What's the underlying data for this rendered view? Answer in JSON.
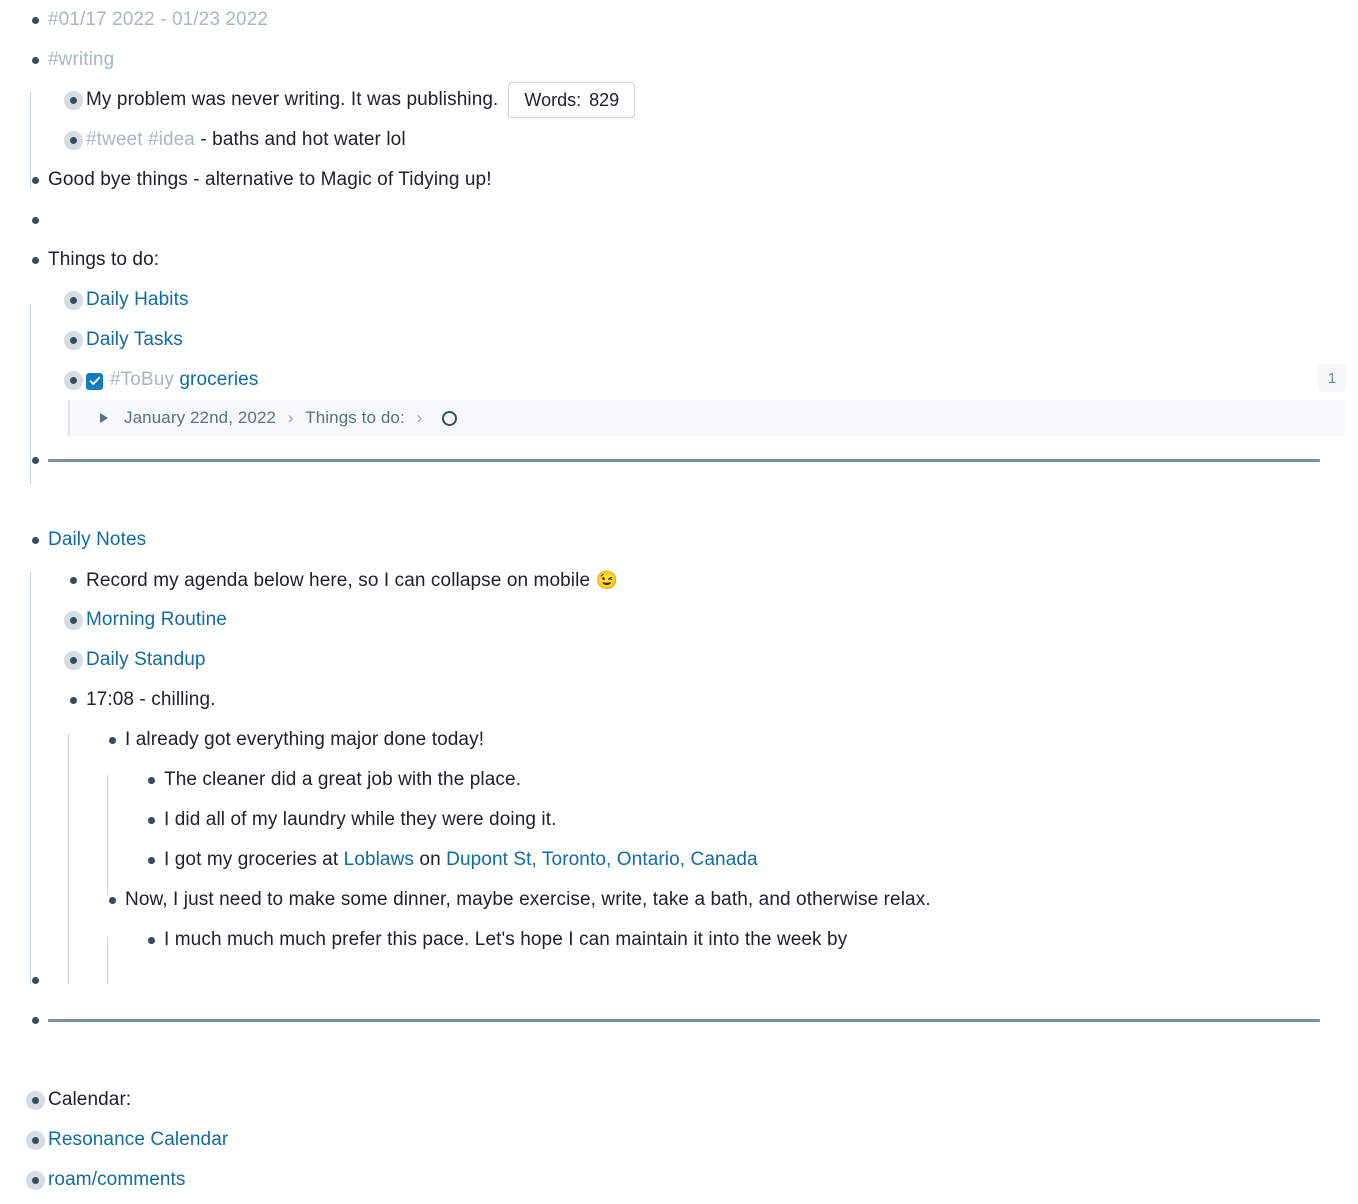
{
  "page": {
    "app": "roam-research-outliner",
    "colors": {
      "text": "#1c2127",
      "link": "#106ba3",
      "tag": "#a7b6c2",
      "bullet": "#3b4a5a",
      "bullet_halo": "#d5dce3",
      "guide": "#c8d2dc",
      "divider": "#7b8fa3",
      "breadcrumb_bg": "#f7f8fa",
      "checkbox": "#137cbd",
      "badge_bg": "#f4f6f8"
    }
  },
  "blocks": {
    "week_tag": "#01/17 2022 - 01/23 2022",
    "writing_tag": "#writing",
    "writing_children": {
      "quote": "My problem was never writing. It was publishing.",
      "words_label": "Words:",
      "words_value": "829",
      "tweet_tag": "#tweet",
      "idea_tag": "#idea",
      "tweet_text": "- baths and hot water lol"
    },
    "goodbye_things": "Good bye things - alternative to Magic of Tidying up!",
    "things_to_do_header": "Things to do:",
    "things_to_do": {
      "daily_habits": "Daily Habits",
      "daily_tasks": "Daily Tasks",
      "tobuy_tag": "#ToBuy",
      "tobuy_text": "groceries",
      "ref_count": "1",
      "breadcrumb": {
        "date": "January 22nd, 2022",
        "separator": "›",
        "parent": "Things to do:"
      }
    },
    "daily_notes": {
      "title": "Daily Notes",
      "record_agenda": "Record my agenda below here, so I can collapse on mobile",
      "record_agenda_emoji": "😉",
      "morning_routine": "Morning Routine",
      "daily_standup": "Daily Standup",
      "chilling": "17:08 - chilling.",
      "major_done": "I already got everything major done today!",
      "cleaner": "The cleaner did a great job with the place.",
      "laundry": "I did all of my laundry while they were doing it.",
      "groceries_prefix": "I got my groceries at ",
      "groceries_store": "Loblaws",
      "groceries_mid": " on ",
      "groceries_address": "Dupont St, Toronto, Ontario, Canada",
      "dinner_plan": "Now, I just need to make some dinner, maybe exercise, write, take a bath, and otherwise relax.",
      "pace": "I much much much prefer this pace. Let's hope I can maintain it into the week by"
    },
    "footer": {
      "calendar_label": "Calendar:",
      "resonance_calendar": "Resonance Calendar",
      "roam_comments": "roam/comments"
    }
  }
}
